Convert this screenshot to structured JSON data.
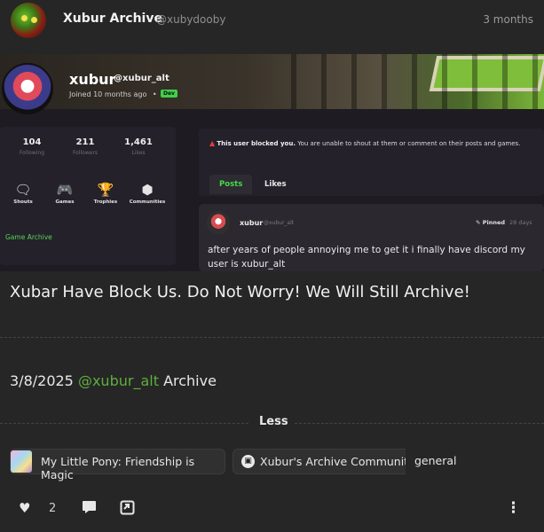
{
  "header": {
    "author_name": "Xubur Archive",
    "author_handle": "@xubydooby",
    "time": "3 months"
  },
  "embed": {
    "profile": {
      "name": "xubur",
      "handle": "@xubur_alt",
      "joined": "Joined 10 months ago",
      "separator": "•",
      "badge": "Dev"
    },
    "stats": [
      {
        "value": "104",
        "label": "Following"
      },
      {
        "value": "211",
        "label": "Followers"
      },
      {
        "value": "1,461",
        "label": "Likes"
      }
    ],
    "nav": [
      {
        "label": "Shouts",
        "icon": "speech-bubble-icon",
        "glyph": "🗨"
      },
      {
        "label": "Games",
        "icon": "gamepad-icon",
        "glyph": "🎮"
      },
      {
        "label": "Trophies",
        "icon": "trophy-icon",
        "glyph": "🏆"
      },
      {
        "label": "Communities",
        "icon": "dots-grid-icon",
        "glyph": "⬢"
      }
    ],
    "game_archive_link": "Game Archive",
    "blocked": {
      "bold": "This user blocked you.",
      "rest": "You are unable to shout at them or comment on their posts and games."
    },
    "tabs": [
      "Posts",
      "Likes"
    ],
    "post": {
      "user": "xubur",
      "handle": "@xubur_alt",
      "pinned": "Pinned",
      "age": "28 days",
      "text": "after years of people annoying me to get it i finally have discord my user is xubur_alt"
    }
  },
  "headline": "Xubar Have Block Us. Do Not Worry! We Will Still Archive!",
  "date_line": {
    "date": "3/8/2025",
    "mention": "@xubur_alt",
    "suffix": "Archive"
  },
  "less_label": "Less",
  "tags": {
    "game": "My Little Pony: Friendship is Magic",
    "community": "Xubur's Archive Community",
    "channel": "general"
  },
  "actions": {
    "like_count": "2"
  },
  "colors": {
    "background": "#262626",
    "accent_green": "#5fae3e",
    "embed_green": "#45d94a",
    "blocked_red": "#e0403c"
  }
}
